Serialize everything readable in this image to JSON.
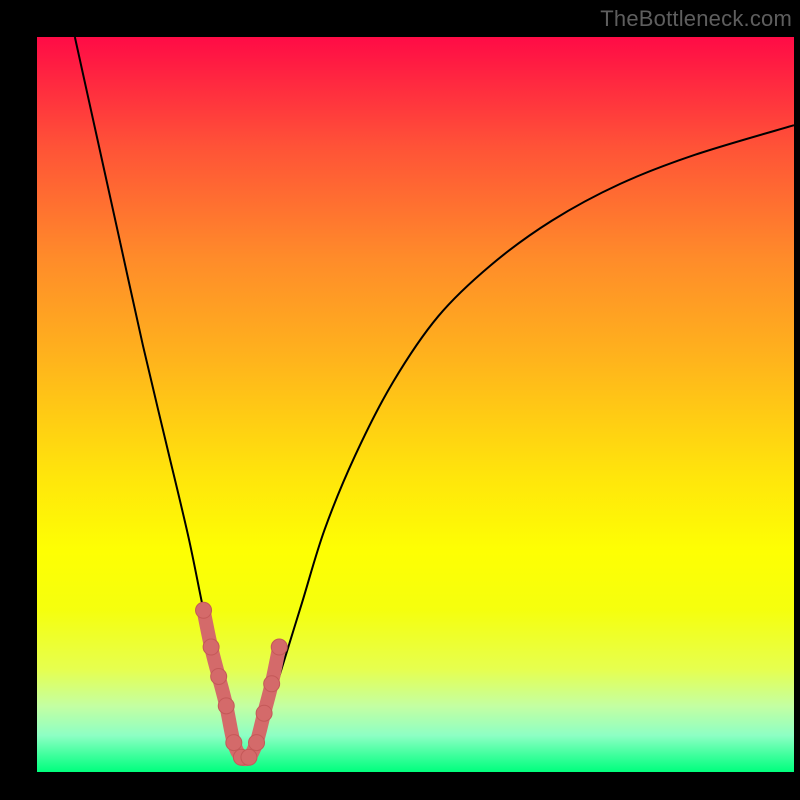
{
  "watermark": "TheBottleneck.com",
  "colors": {
    "frame": "#000000",
    "curve": "#000000",
    "marker_fill": "#d46a6a",
    "marker_stroke": "#c45858",
    "gradient_stops": [
      {
        "pct": 0,
        "hex": "#ff0b46"
      },
      {
        "pct": 15,
        "hex": "#ff5337"
      },
      {
        "pct": 30,
        "hex": "#ff8b2a"
      },
      {
        "pct": 44,
        "hex": "#ffb41c"
      },
      {
        "pct": 60,
        "hex": "#ffe60b"
      },
      {
        "pct": 70,
        "hex": "#feff03"
      },
      {
        "pct": 78,
        "hex": "#f5ff0e"
      },
      {
        "pct": 86,
        "hex": "#e6ff4f"
      },
      {
        "pct": 91,
        "hex": "#c4ffa2"
      },
      {
        "pct": 95,
        "hex": "#8effc4"
      },
      {
        "pct": 98,
        "hex": "#36ff99"
      },
      {
        "pct": 100,
        "hex": "#00ff7d"
      }
    ]
  },
  "chart_data": {
    "type": "line",
    "title": "",
    "xlabel": "",
    "ylabel": "",
    "x_range": [
      0,
      100
    ],
    "y_range": [
      0,
      100
    ],
    "note": "V-shaped bottleneck curve. y≈100 means severe bottleneck (red), y≈0 means balanced (green). Minimum around x≈27.",
    "series": [
      {
        "name": "bottleneck-curve",
        "x": [
          5,
          8,
          11,
          14,
          17,
          20,
          22,
          24,
          25.5,
          27,
          28.5,
          30,
          32,
          35,
          38,
          42,
          47,
          53,
          60,
          68,
          77,
          87,
          100
        ],
        "y": [
          100,
          86,
          72,
          58,
          45,
          32,
          22,
          13,
          6,
          2,
          2,
          6,
          13,
          23,
          33,
          43,
          53,
          62,
          69,
          75,
          80,
          84,
          88
        ]
      }
    ],
    "highlight": {
      "name": "optimal-band",
      "x": [
        22,
        23,
        24,
        25,
        26,
        27,
        28,
        29,
        30,
        31,
        32
      ],
      "y": [
        22,
        17,
        13,
        9,
        4,
        2,
        2,
        4,
        8,
        12,
        17
      ]
    }
  }
}
